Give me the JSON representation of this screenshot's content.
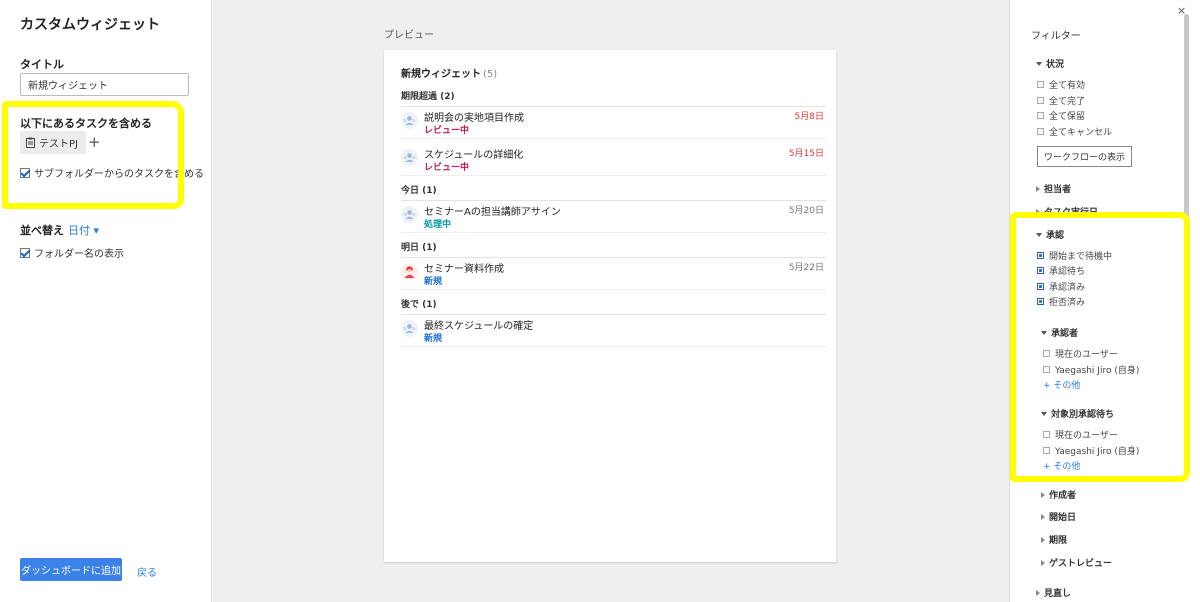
{
  "left": {
    "title": "カスタムウィジェット",
    "title_label": "タイトル",
    "title_value": "新規ウィジェット",
    "include_label": "以下にあるタスクを含める",
    "chip_label": "テストPJ",
    "plus": "+",
    "subfolder_label": "サブフォルダーからのタスクを含める",
    "sort_label": "並べ替え",
    "sort_value": "日付 ▾",
    "folder_name_label": "フォルダー名の表示",
    "add_button": "ダッシュボードに追加",
    "back_link": "戻る"
  },
  "preview": {
    "label": "プレビュー",
    "card_title": "新規ウィジェット",
    "card_count": "(5)",
    "groups": [
      {
        "label": "期限超過 (2)"
      },
      {
        "label": "今日 (1)"
      },
      {
        "label": "明日 (1)"
      },
      {
        "label": "後で (1)"
      }
    ],
    "tasks": [
      {
        "name": "説明会の実地項目作成",
        "status": "レビュー中",
        "date": "5月8日"
      },
      {
        "name": "スケジュールの詳細化",
        "status": "レビュー中",
        "date": "5月15日"
      },
      {
        "name": "セミナーAの担当講師アサイン",
        "status": "処理中",
        "date": "5月20日"
      },
      {
        "name": "セミナー資料作成",
        "status": "新規",
        "date": "5月22日"
      },
      {
        "name": "最終スケジュールの確定",
        "status": "新規",
        "date": ""
      }
    ]
  },
  "filter": {
    "close": "×",
    "title": "フィルター",
    "status_section": "状況",
    "status_options": [
      "全て有効",
      "全て完了",
      "全て保留",
      "全てキャンセル"
    ],
    "workflow_button": "ワークフローの表示",
    "assignee_section": "担当者",
    "date_section": "タスク実行日",
    "approval_section": "承認",
    "approval_options": [
      "開始まで待機中",
      "承認待ち",
      "承認済み",
      "拒否済み"
    ],
    "approver_section": "承認者",
    "approver_options": [
      "現在のユーザー",
      "Yaegashi Jiro (自身)"
    ],
    "approver_more": "+ その他",
    "pending_section": "対象別承認待ち",
    "pending_options": [
      "現在のユーザー",
      "Yaegashi Jiro (自身)"
    ],
    "pending_more": "+ その他",
    "creator_section": "作成者",
    "start_section": "開始日",
    "due_section": "期限",
    "guest_section": "ゲストレビュー",
    "bottom_section": "見直し"
  },
  "colors": {
    "highlight": "#ffff00",
    "accent": "#3b82e8",
    "review": "#c2185b",
    "in_progress": "#0097a7",
    "new": "#1e6fd9",
    "overdue": "#e53935"
  }
}
